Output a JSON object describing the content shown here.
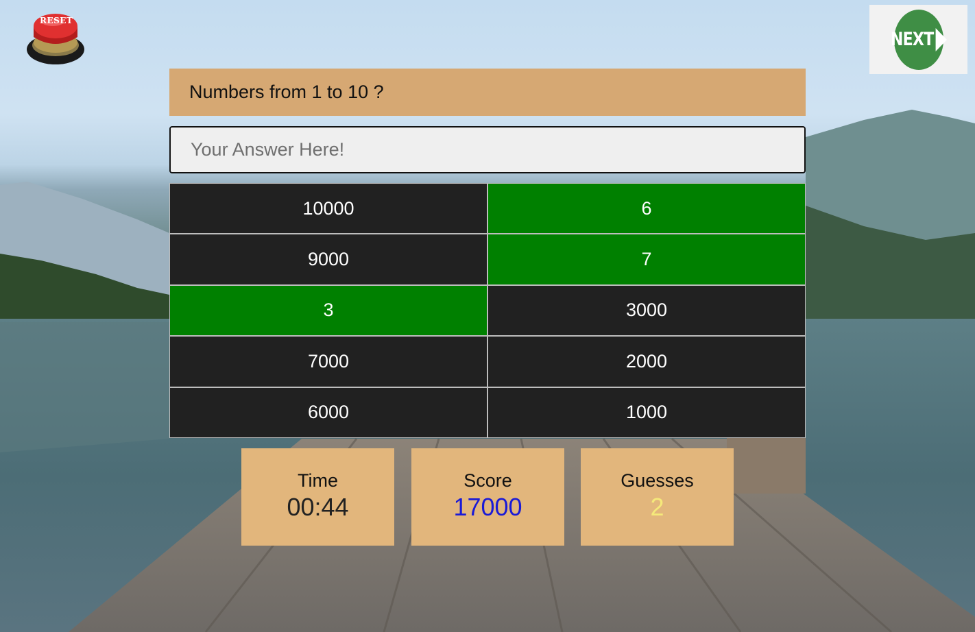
{
  "reset_button": {
    "label": "RESET"
  },
  "next_button": {
    "label": "NEXT"
  },
  "question": {
    "text": "Numbers from 1 to 10 ?"
  },
  "answer_input": {
    "placeholder": "Your Answer Here!",
    "value": ""
  },
  "grid": {
    "cells": [
      {
        "label": "10000",
        "found": false
      },
      {
        "label": "6",
        "found": true
      },
      {
        "label": "9000",
        "found": false
      },
      {
        "label": "7",
        "found": true
      },
      {
        "label": "3",
        "found": true
      },
      {
        "label": "3000",
        "found": false
      },
      {
        "label": "7000",
        "found": false
      },
      {
        "label": "2000",
        "found": false
      },
      {
        "label": "6000",
        "found": false
      },
      {
        "label": "1000",
        "found": false
      }
    ],
    "colors": {
      "hidden": "#212121",
      "found": "#008000"
    }
  },
  "stats": {
    "time": {
      "label": "Time",
      "value": "00:44",
      "color": "#222222"
    },
    "score": {
      "label": "Score",
      "value": "17000",
      "color": "#1a1ad6"
    },
    "guesses": {
      "label": "Guesses",
      "value": "2",
      "color": "#f5e97a"
    }
  }
}
